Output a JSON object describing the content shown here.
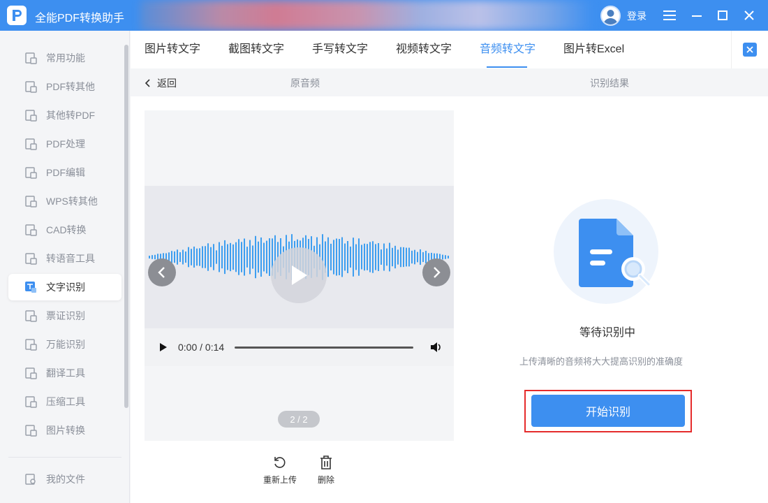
{
  "app": {
    "title": "全能PDF转换助手",
    "login_label": "登录"
  },
  "colors": {
    "accent": "#3d8ff0",
    "highlight": "#e52b2b"
  },
  "sidebar": {
    "items": [
      {
        "label": "常用功能",
        "icon": "home-grid-icon"
      },
      {
        "label": "PDF转其他",
        "icon": "pdf-convert-icon"
      },
      {
        "label": "其他转PDF",
        "icon": "to-pdf-icon"
      },
      {
        "label": "PDF处理",
        "icon": "pdf-process-icon"
      },
      {
        "label": "PDF编辑",
        "icon": "pdf-edit-icon"
      },
      {
        "label": "WPS转其他",
        "icon": "wps-icon"
      },
      {
        "label": "CAD转换",
        "icon": "cad-icon"
      },
      {
        "label": "转语音工具",
        "icon": "voice-icon"
      },
      {
        "label": "文字识别",
        "icon": "ocr-icon",
        "active": true
      },
      {
        "label": "票证识别",
        "icon": "ticket-icon"
      },
      {
        "label": "万能识别",
        "icon": "universal-scan-icon"
      },
      {
        "label": "翻译工具",
        "icon": "translate-icon"
      },
      {
        "label": "压缩工具",
        "icon": "zip-icon"
      },
      {
        "label": "图片转换",
        "icon": "image-convert-icon"
      }
    ],
    "my_files": "我的文件"
  },
  "tabs": [
    {
      "label": "图片转文字"
    },
    {
      "label": "截图转文字"
    },
    {
      "label": "手写转文字"
    },
    {
      "label": "视频转文字"
    },
    {
      "label": "音频转文字",
      "active": true
    },
    {
      "label": "图片转Excel"
    }
  ],
  "subheader": {
    "back": "返回",
    "source_label": "原音频",
    "result_label": "识别结果"
  },
  "player": {
    "time": "0:00 / 0:14",
    "page": "2 / 2"
  },
  "actions": {
    "reupload": "重新上传",
    "delete": "删除"
  },
  "result": {
    "status": "等待识别中",
    "hint": "上传清晰的音频将大大提高识别的准确度",
    "start_button": "开始识别"
  }
}
